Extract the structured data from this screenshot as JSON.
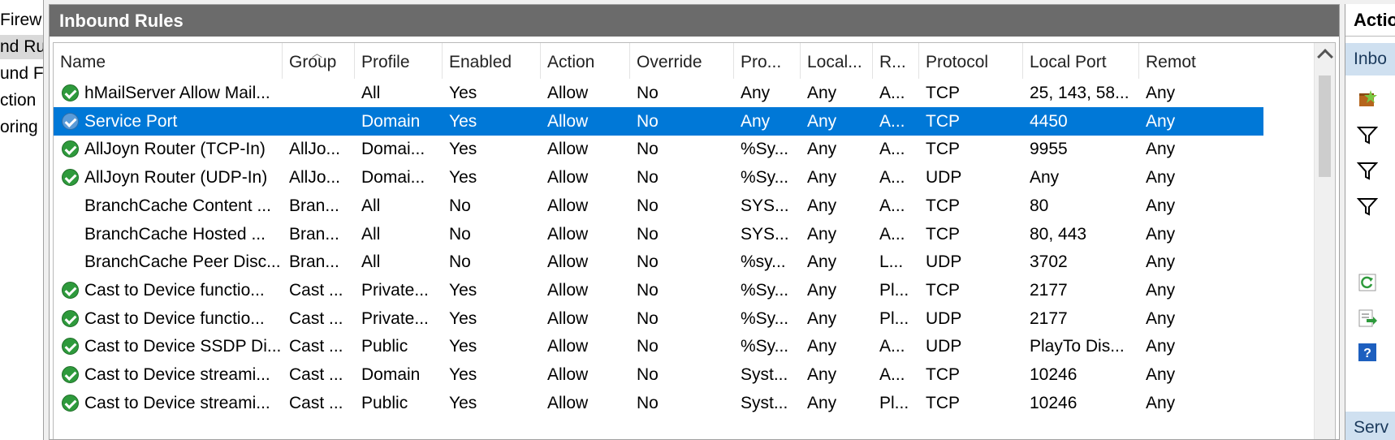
{
  "tree": {
    "items": [
      {
        "label": "Firew",
        "selected": false
      },
      {
        "label": "nd Ru",
        "selected": true
      },
      {
        "label": "und F",
        "selected": false
      },
      {
        "label": "ction",
        "selected": false
      },
      {
        "label": "oring",
        "selected": false
      }
    ]
  },
  "center": {
    "title": "Inbound Rules"
  },
  "columns": [
    "Name",
    "Group",
    "Profile",
    "Enabled",
    "Action",
    "Override",
    "Pro...",
    "Local...",
    "R...",
    "Protocol",
    "Local Port",
    "Remot"
  ],
  "rows": [
    {
      "icon": true,
      "selected": false,
      "cells": [
        "hMailServer Allow Mail...",
        "",
        "All",
        "Yes",
        "Allow",
        "No",
        "Any",
        "Any",
        "A...",
        "TCP",
        "25, 143, 58...",
        "Any"
      ]
    },
    {
      "icon": true,
      "selected": true,
      "cells": [
        "Service Port",
        "",
        "Domain",
        "Yes",
        "Allow",
        "No",
        "Any",
        "Any",
        "A...",
        "TCP",
        "4450",
        "Any"
      ]
    },
    {
      "icon": true,
      "selected": false,
      "cells": [
        "AllJoyn Router (TCP-In)",
        "AllJo...",
        "Domai...",
        "Yes",
        "Allow",
        "No",
        "%Sy...",
        "Any",
        "A...",
        "TCP",
        "9955",
        "Any"
      ]
    },
    {
      "icon": true,
      "selected": false,
      "cells": [
        "AllJoyn Router (UDP-In)",
        "AllJo...",
        "Domai...",
        "Yes",
        "Allow",
        "No",
        "%Sy...",
        "Any",
        "A...",
        "UDP",
        "Any",
        "Any"
      ]
    },
    {
      "icon": false,
      "selected": false,
      "cells": [
        "BranchCache Content ...",
        "Bran...",
        "All",
        "No",
        "Allow",
        "No",
        "SYS...",
        "Any",
        "A...",
        "TCP",
        "80",
        "Any"
      ]
    },
    {
      "icon": false,
      "selected": false,
      "cells": [
        "BranchCache Hosted ...",
        "Bran...",
        "All",
        "No",
        "Allow",
        "No",
        "SYS...",
        "Any",
        "A...",
        "TCP",
        "80, 443",
        "Any"
      ]
    },
    {
      "icon": false,
      "selected": false,
      "cells": [
        "BranchCache Peer Disc...",
        "Bran...",
        "All",
        "No",
        "Allow",
        "No",
        "%sy...",
        "Any",
        "L...",
        "UDP",
        "3702",
        "Any"
      ]
    },
    {
      "icon": true,
      "selected": false,
      "cells": [
        "Cast to Device functio...",
        "Cast ...",
        "Private...",
        "Yes",
        "Allow",
        "No",
        "%Sy...",
        "Any",
        "Pl...",
        "TCP",
        "2177",
        "Any"
      ]
    },
    {
      "icon": true,
      "selected": false,
      "cells": [
        "Cast to Device functio...",
        "Cast ...",
        "Private...",
        "Yes",
        "Allow",
        "No",
        "%Sy...",
        "Any",
        "Pl...",
        "UDP",
        "2177",
        "Any"
      ]
    },
    {
      "icon": true,
      "selected": false,
      "cells": [
        "Cast to Device SSDP Di...",
        "Cast ...",
        "Public",
        "Yes",
        "Allow",
        "No",
        "%Sy...",
        "Any",
        "A...",
        "UDP",
        "PlayTo Dis...",
        "Any"
      ]
    },
    {
      "icon": true,
      "selected": false,
      "cells": [
        "Cast to Device streami...",
        "Cast ...",
        "Domain",
        "Yes",
        "Allow",
        "No",
        "Syst...",
        "Any",
        "A...",
        "TCP",
        "10246",
        "Any"
      ]
    },
    {
      "icon": true,
      "selected": false,
      "cells": [
        "Cast to Device streami...",
        "Cast ...",
        "Public",
        "Yes",
        "Allow",
        "No",
        "Syst...",
        "Any",
        "Pl...",
        "TCP",
        "10246",
        "Any"
      ]
    }
  ],
  "actions": {
    "title": "Actio",
    "subtitle": "Inbo",
    "bottom_subtitle": "Serv",
    "icons": [
      "new-rule-icon",
      "filter-profile-icon",
      "filter-state-icon",
      "filter-group-icon",
      "refresh-icon",
      "export-list-icon",
      "help-icon"
    ]
  },
  "colors": {
    "header_bg": "#6b6b6b",
    "selection": "#0078d7",
    "enabled_icon": "#2e9a3c",
    "actions_subheader": "#cfe0f0"
  }
}
